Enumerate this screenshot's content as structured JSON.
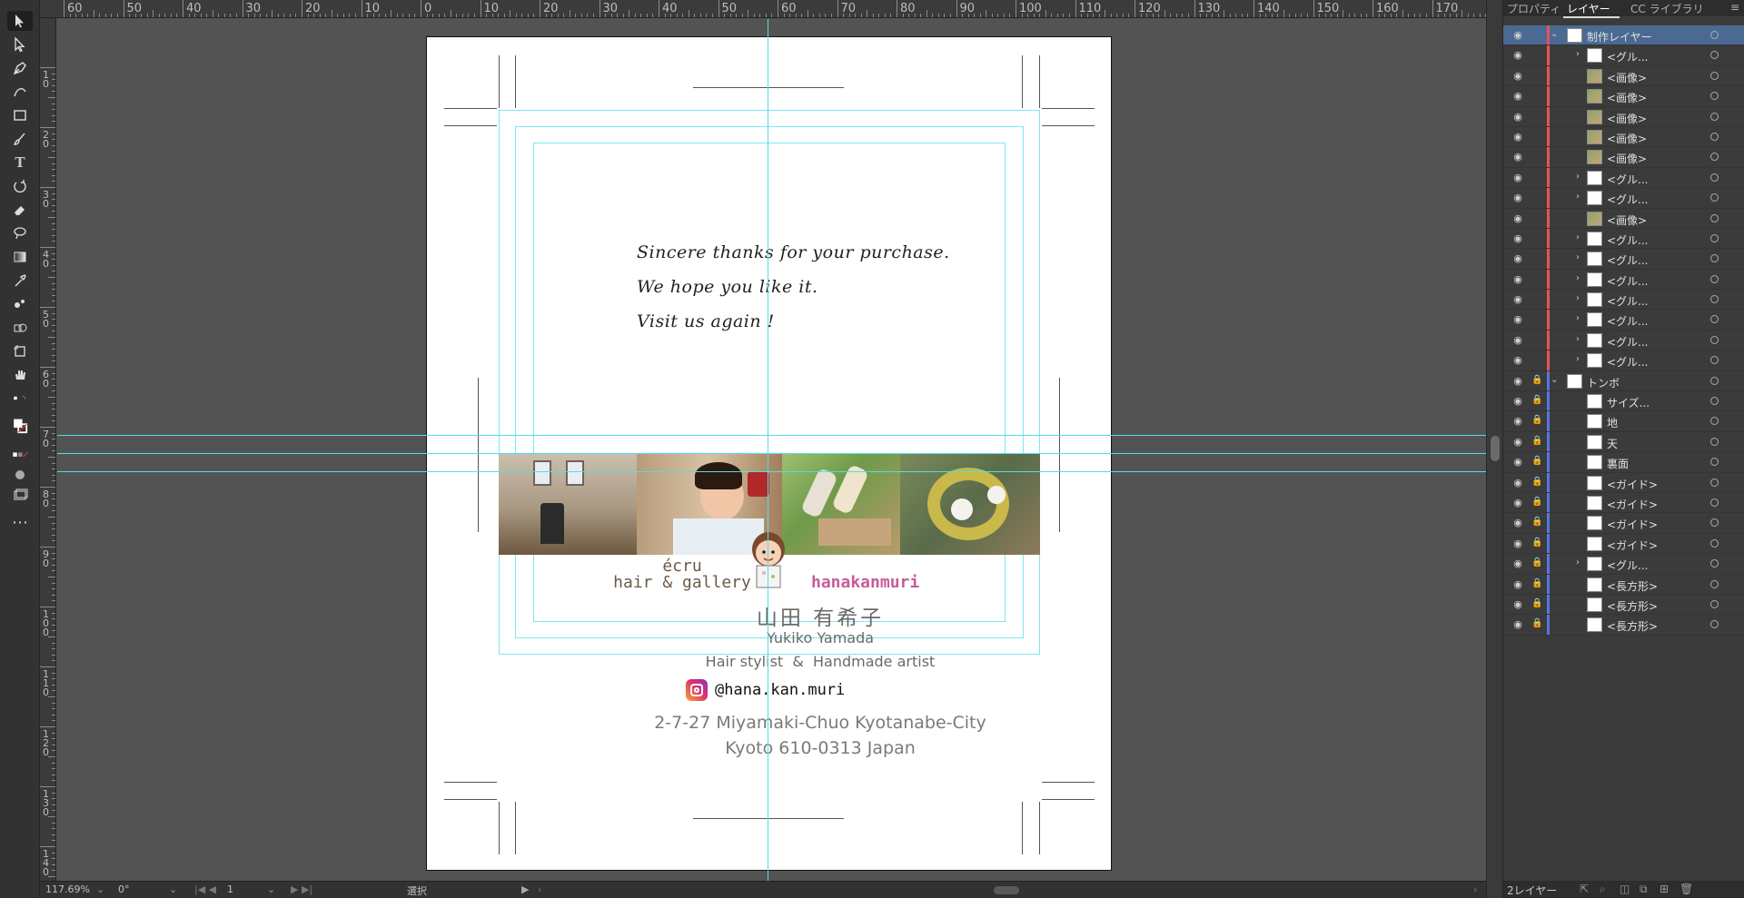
{
  "app": {
    "accent": "#4b6a93",
    "guide_color": "#4fe0e6"
  },
  "ruler": {
    "top_labels": [
      "60",
      "50",
      "40",
      "30",
      "20",
      "10",
      "0",
      "10",
      "20",
      "30",
      "40",
      "50",
      "60",
      "70",
      "80",
      "90",
      "100",
      "110",
      "120",
      "130",
      "140",
      "150",
      "160",
      "170"
    ],
    "left_labels": [
      "1 0",
      "2 0",
      "3 0",
      "4 0",
      "5 0",
      "6 0",
      "7 0",
      "8 0",
      "9 0",
      "1 0 0",
      "1 1 0",
      "1 2 0",
      "1 3 0",
      "1 4 0"
    ]
  },
  "card": {
    "message_lines": [
      "Sincere thanks for your purchase.",
      "We hope you like it.",
      "Visit us again !"
    ],
    "logo_ecru_top": "écru",
    "logo_ecru_bottom": "hair & gallery",
    "logo_hana": "hanakanmuri",
    "name_jp": "山田 有希子",
    "name_en": "Yukiko Yamada",
    "title": "Hair stylist  &  Handmade artist",
    "instagram": "@hana.kan.muri",
    "address_line1": "2-7-27 Miyamaki-Chuo Kyotanabe-City",
    "address_line2": "Kyoto 610-0313 Japan"
  },
  "status": {
    "zoom": "117.69%",
    "rotation": "0°",
    "artboard": "1",
    "mode": "選択"
  },
  "panel": {
    "tabs": [
      "プロパティ",
      "レイヤー",
      "CC ライブラリ"
    ],
    "footer_label": "2レイヤー",
    "layers": [
      {
        "name": "制作レイヤー",
        "level": 0,
        "expanded": true,
        "selected": true,
        "color": "#e25555",
        "locked": false
      },
      {
        "name": "<グル...",
        "level": 1,
        "arrow": true,
        "color": "#e25555"
      },
      {
        "name": "<画像>",
        "level": 1,
        "color": "#e25555"
      },
      {
        "name": "<画像>",
        "level": 1,
        "color": "#e25555"
      },
      {
        "name": "<画像>",
        "level": 1,
        "color": "#e25555"
      },
      {
        "name": "<画像>",
        "level": 1,
        "color": "#e25555"
      },
      {
        "name": "<画像>",
        "level": 1,
        "color": "#e25555"
      },
      {
        "name": "<グル...",
        "level": 1,
        "arrow": true,
        "color": "#e25555"
      },
      {
        "name": "<グル...",
        "level": 1,
        "arrow": true,
        "color": "#e25555"
      },
      {
        "name": "<画像>",
        "level": 1,
        "color": "#e25555"
      },
      {
        "name": "<グル...",
        "level": 1,
        "arrow": true,
        "color": "#e25555"
      },
      {
        "name": "<グル...",
        "level": 1,
        "arrow": true,
        "color": "#e25555"
      },
      {
        "name": "<グル...",
        "level": 1,
        "arrow": true,
        "color": "#e25555"
      },
      {
        "name": "<グル...",
        "level": 1,
        "arrow": true,
        "color": "#e25555"
      },
      {
        "name": "<グル...",
        "level": 1,
        "arrow": true,
        "color": "#e25555"
      },
      {
        "name": "<グル...",
        "level": 1,
        "arrow": true,
        "color": "#e25555"
      },
      {
        "name": "<グル...",
        "level": 1,
        "arrow": true,
        "color": "#e25555"
      },
      {
        "name": "トンボ",
        "level": 0,
        "expanded": true,
        "color": "#5577dd",
        "locked": true
      },
      {
        "name": "サイズ...",
        "level": 1,
        "color": "#5577dd",
        "locked": true
      },
      {
        "name": "地",
        "level": 1,
        "color": "#5577dd",
        "locked": true
      },
      {
        "name": "天",
        "level": 1,
        "color": "#5577dd",
        "locked": true
      },
      {
        "name": "裏面",
        "level": 1,
        "color": "#5577dd",
        "locked": true
      },
      {
        "name": "<ガイド>",
        "level": 1,
        "color": "#5577dd",
        "locked": true
      },
      {
        "name": "<ガイド>",
        "level": 1,
        "color": "#5577dd",
        "locked": true
      },
      {
        "name": "<ガイド>",
        "level": 1,
        "color": "#5577dd",
        "locked": true
      },
      {
        "name": "<ガイド>",
        "level": 1,
        "color": "#5577dd",
        "locked": true
      },
      {
        "name": "<グル...",
        "level": 1,
        "arrow": true,
        "color": "#5577dd",
        "locked": true
      },
      {
        "name": "<長方形>",
        "level": 1,
        "color": "#5577dd",
        "locked": true
      },
      {
        "name": "<長方形>",
        "level": 1,
        "color": "#5577dd",
        "locked": true
      },
      {
        "name": "<長方形>",
        "level": 1,
        "color": "#5577dd",
        "locked": true
      }
    ]
  }
}
